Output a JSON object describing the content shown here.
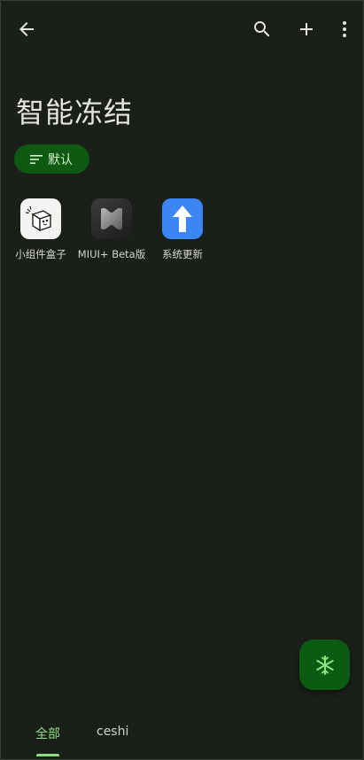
{
  "topbar": {
    "back_icon": "arrow-back-icon",
    "search_icon": "search-icon",
    "add_icon": "plus-icon",
    "more_icon": "more-vert-icon"
  },
  "page": {
    "title": "智能冻结"
  },
  "sort_chip": {
    "label": "默认",
    "icon": "sort-icon"
  },
  "apps": [
    {
      "label": "小组件盒子",
      "icon": "widget-box-app-icon"
    },
    {
      "label": "MIUI+ Beta版",
      "icon": "miui-plus-app-icon"
    },
    {
      "label": "系统更新",
      "icon": "system-update-app-icon"
    }
  ],
  "fab": {
    "icon": "snowflake-icon"
  },
  "tabs": [
    {
      "label": "全部",
      "selected": true
    },
    {
      "label": "ceshi",
      "selected": false
    }
  ],
  "colors": {
    "background": "#1b1f1a",
    "accent": "#8ee07f",
    "chip_bg": "#0e5a13",
    "fab_bg": "#0b5c12"
  }
}
